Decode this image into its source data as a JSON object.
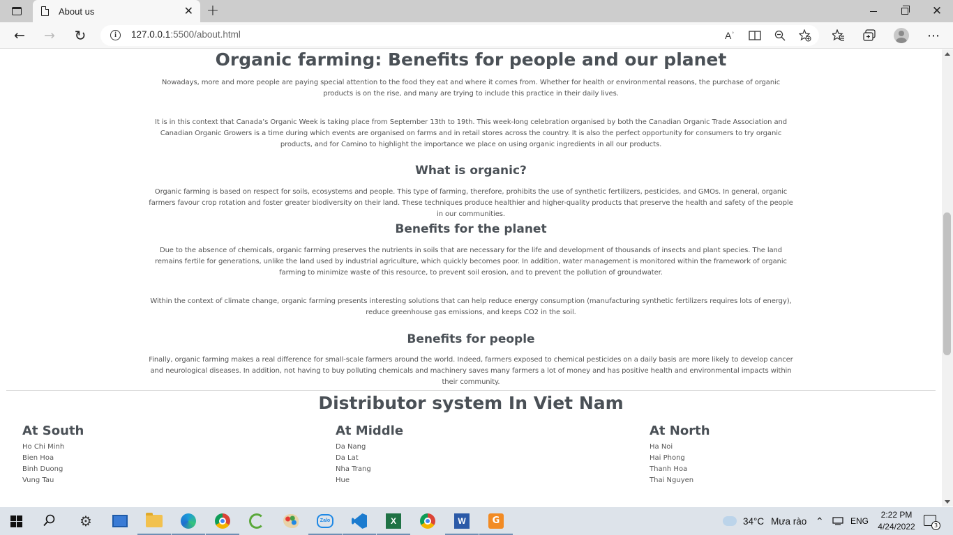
{
  "browser": {
    "tab_title": "About us",
    "tab_close": "✕",
    "new_tab": "+",
    "url_host": "127.0.0.1",
    "url_rest": ":5500/about.html",
    "read_aloud_label": "Aʾ"
  },
  "article": {
    "title": "Organic farming: Benefits for people and our planet",
    "intro_1": "Nowadays, more and more people are paying special attention to the food they eat and where it comes from. Whether for health or environmental reasons, the purchase of organic products is on the rise, and many are trying to include this practice in their daily lives.",
    "intro_2": "It is in this context that Canada’s Organic Week is taking place from September 13th to 19th. This week-long celebration organised by both the Canadian Organic Trade Association and Canadian Organic Growers is a time during which events are organised on farms and in retail stores across the country. It is also the perfect opportunity for consumers to try organic products, and for Camino to highlight the importance we place on using organic ingredients in all our products.",
    "what_heading": "What is organic?",
    "what_text": "Organic farming is based on respect for soils, ecosystems and people. This type of farming, therefore, prohibits the use of synthetic fertilizers, pesticides, and GMOs. In general, organic farmers favour crop rotation and foster greater biodiversity on their land. These techniques produce healthier and higher-quality products that preserve the health and safety of the people in our communities.",
    "planet_heading": "Benefits for the planet",
    "planet_text_1": "Due to the absence of chemicals, organic farming preserves the nutrients in soils that are necessary for the life and development of thousands of insects and plant species. The land remains fertile for generations, unlike the land used by industrial agriculture, which quickly becomes poor. In addition, water management is monitored within the framework of organic farming to minimize waste of this resource, to prevent soil erosion, and to prevent the pollution of groundwater.",
    "planet_text_2": "Within the context of climate change, organic farming presents interesting solutions that can help reduce energy consumption (manufacturing synthetic fertilizers requires lots of energy), reduce greenhouse gas emissions, and keeps CO2 in the soil.",
    "people_heading": "Benefits for people",
    "people_text": "Finally, organic farming makes a real difference for small-scale farmers around the world. Indeed, farmers exposed to chemical pesticides on a daily basis are more likely to develop cancer and neurological diseases. In addition, not having to buy polluting chemicals and machinery saves many farmers a lot of money and has positive health and environmental impacts within their community."
  },
  "distributors": {
    "title": "Distributor system In Viet Nam",
    "regions": [
      {
        "name": "At South",
        "cities": [
          "Ho Chi Minh",
          "Bien Hoa",
          "Binh Duong",
          "Vung Tau"
        ]
      },
      {
        "name": "At Middle",
        "cities": [
          "Da Nang",
          "Da Lat",
          "Nha Trang",
          "Hue"
        ]
      },
      {
        "name": "At North",
        "cities": [
          "Ha Noi",
          "Hai Phong",
          "Thanh Hoa",
          "Thai Nguyen"
        ]
      }
    ]
  },
  "taskbar": {
    "temperature": "34°C",
    "weather_text": "Mưa rào",
    "language": "ENG",
    "time": "2:22 PM",
    "date": "4/24/2022",
    "notification_count": "3",
    "zalo_label": "Zalo",
    "excel_label": "X",
    "word_label": "W",
    "pdf_label": "G"
  }
}
